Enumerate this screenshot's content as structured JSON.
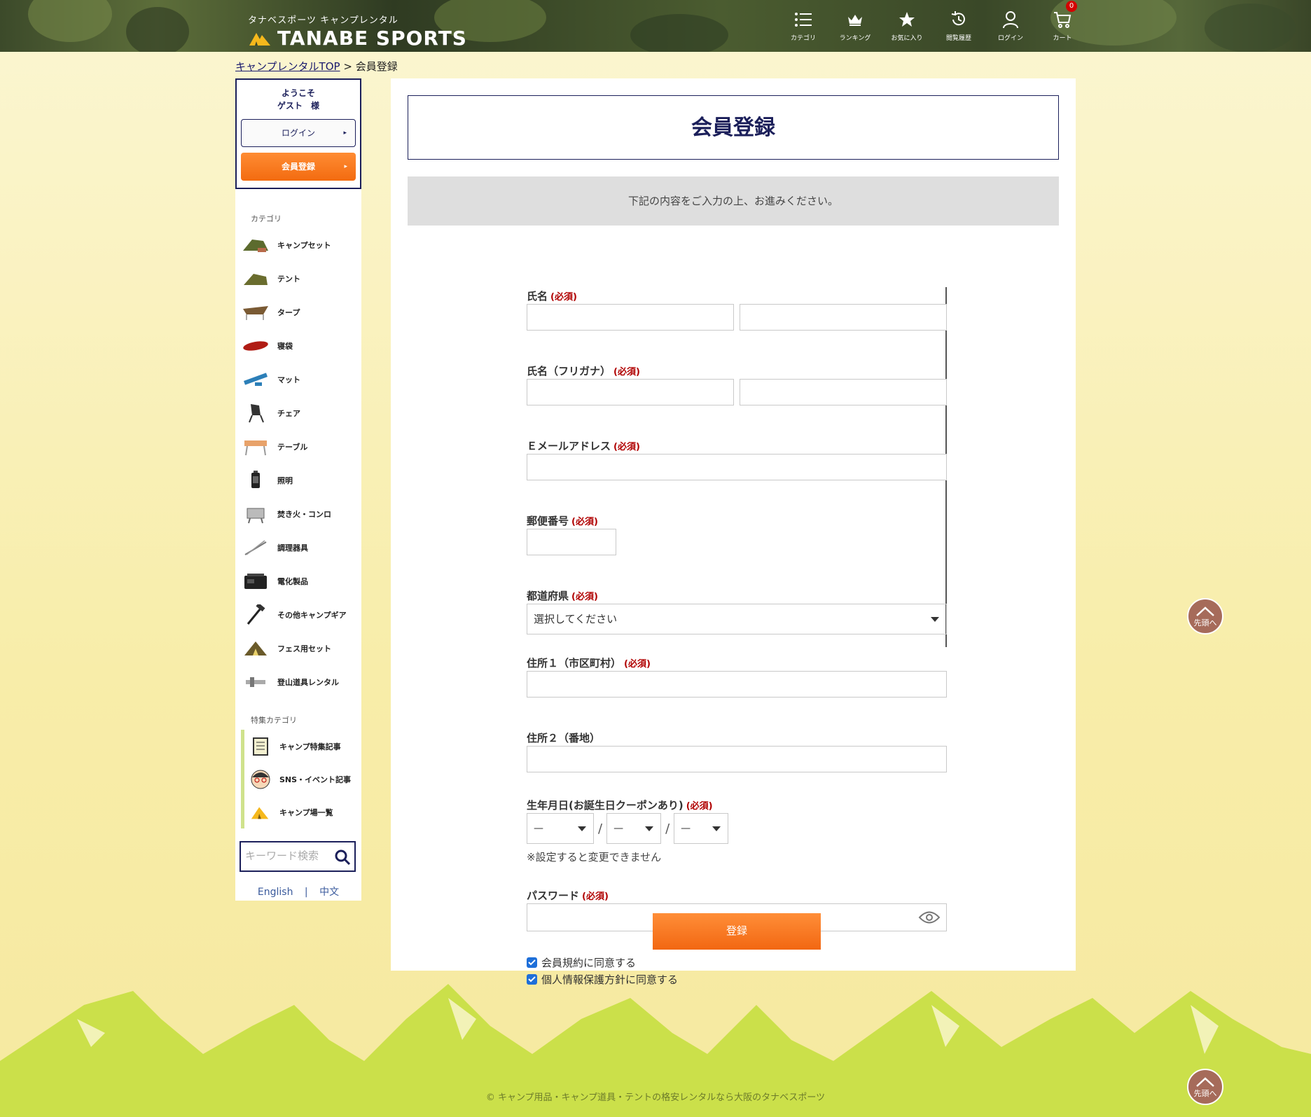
{
  "header": {
    "brand_sub": "タナベスポーツ キャンプレンタル",
    "brand_name": "TANABE SPORTS",
    "nav": [
      {
        "label": "カテゴリ",
        "icon": "list-icon"
      },
      {
        "label": "ランキング",
        "icon": "crown-icon"
      },
      {
        "label": "お気に入り",
        "icon": "star-icon"
      },
      {
        "label": "閲覧履歴",
        "icon": "history-icon"
      },
      {
        "label": "ログイン",
        "icon": "user-icon"
      },
      {
        "label": "カート",
        "icon": "cart-icon"
      }
    ],
    "cart_count": "0"
  },
  "breadcrumb": {
    "home": "キャンプレンタルTOP",
    "separator": ">",
    "current": "会員登録"
  },
  "sidebar": {
    "welcome_line1": "ようこそ",
    "welcome_line2": "ゲスト　様",
    "login_label": "ログイン",
    "register_label": "会員登録",
    "category_heading": "カテゴリ",
    "categories": [
      "キャンプセット",
      "テント",
      "タープ",
      "寝袋",
      "マット",
      "チェア",
      "テーブル",
      "照明",
      "焚き火・コンロ",
      "調理器具",
      "電化製品",
      "その他キャンプギア",
      "フェス用セット",
      "登山道具レンタル"
    ],
    "special_heading": "特集カテゴリ",
    "specials": [
      "キャンプ特集記事",
      "SNS・イベント記事",
      "キャンプ場一覧"
    ],
    "search_placeholder": "キーワード検索",
    "lang_en": "English",
    "lang_sep": "|",
    "lang_zh": "中文"
  },
  "main": {
    "title": "会員登録",
    "notice": "下記の内容をご入力の上、お進みください。",
    "required": "(必須)",
    "name_label": "氏名",
    "kana_label": "氏名（フリガナ）",
    "email_label": "Ｅメールアドレス",
    "zip_label": "郵便番号",
    "pref_label": "都道府県",
    "pref_value": "選択してください",
    "addr1_label": "住所１（市区町村）",
    "addr2_label": "住所２（番地）",
    "birthday_label": "生年月日(お誕生日クーポンあり)",
    "birthday_placeholder": "—",
    "birthday_sep": "/",
    "birthday_note": "※設定すると変更できません",
    "password_label": "パスワード",
    "agree_terms": "会員規約に同意する",
    "agree_privacy": "個人情報保護方針に同意する",
    "submit_label": "登録"
  },
  "footer": {
    "copyright": "© キャンプ用品・キャンプ道具・テントの格安レンタルなら大阪のタナベスポーツ",
    "to_top_label": "先頭へ"
  },
  "colors": {
    "navy": "#1b1f5a",
    "orange": "#f36b10",
    "required_red": "#b00000",
    "bg_cream": "#f8eda9",
    "mountain_green": "#cbe04a"
  }
}
